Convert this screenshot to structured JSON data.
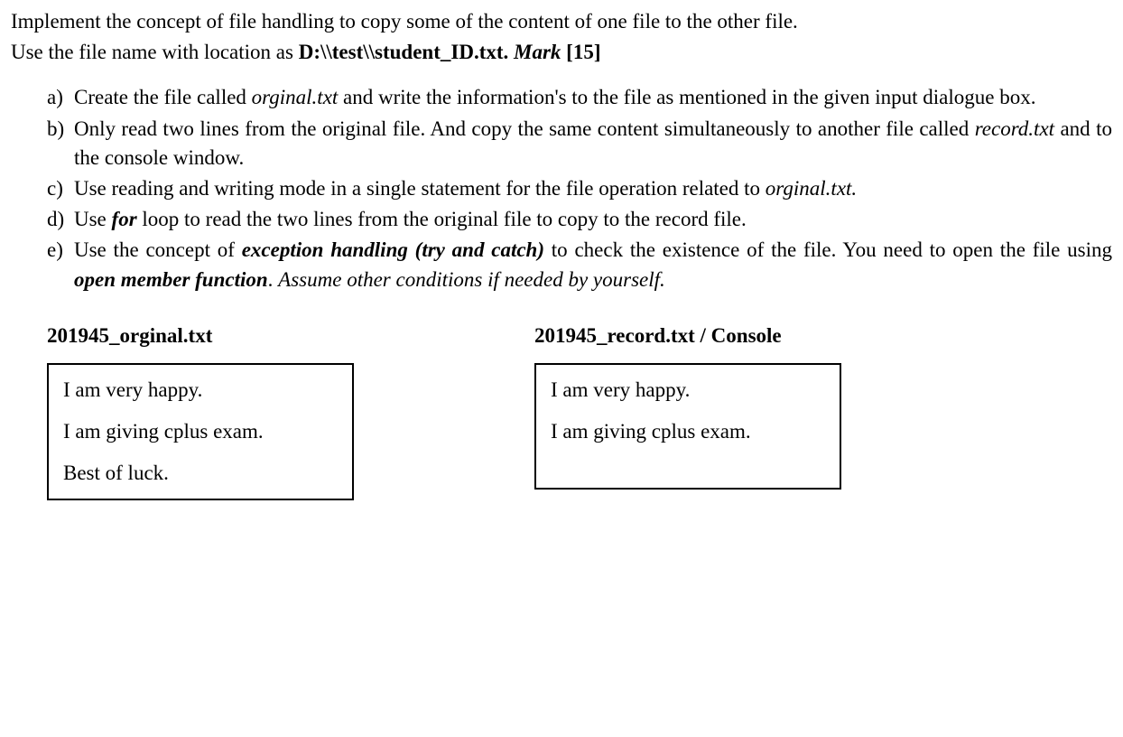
{
  "intro": {
    "line1": "Implement the concept of file handling to copy some of the content of one file to the other file.",
    "line2_prefix": "Use the file name with location as ",
    "line2_bold": "D:\\\\test\\\\student_ID.txt. ",
    "line2_mark_italic": "Mark",
    "line2_mark_suffix": " [15]"
  },
  "items": [
    {
      "marker": "a)",
      "parts": [
        {
          "text": "Create the file called ",
          "style": ""
        },
        {
          "text": "orginal.txt",
          "style": "italic"
        },
        {
          "text": " and write the information's to the file as mentioned in the given input dialogue box.",
          "style": ""
        }
      ]
    },
    {
      "marker": "b)",
      "parts": [
        {
          "text": "Only read two lines from the original file. And copy the same content simultaneously to another file called ",
          "style": ""
        },
        {
          "text": "record.txt",
          "style": "italic"
        },
        {
          "text": " and to the console window.",
          "style": ""
        }
      ]
    },
    {
      "marker": "c)",
      "parts": [
        {
          "text": "Use reading and writing mode in a single statement for the file operation related to ",
          "style": ""
        },
        {
          "text": "orginal.txt.",
          "style": "italic"
        }
      ]
    },
    {
      "marker": "d)",
      "parts": [
        {
          "text": "Use ",
          "style": ""
        },
        {
          "text": "for",
          "style": "bold-italic"
        },
        {
          "text": " loop to read the two lines from the original file to copy to the record file.",
          "style": ""
        }
      ]
    },
    {
      "marker": "e)",
      "parts": [
        {
          "text": "Use the concept of ",
          "style": ""
        },
        {
          "text": "exception handling (try and catch)",
          "style": "bold-italic"
        },
        {
          "text": " to check the existence of the file. You need to open the file using ",
          "style": ""
        },
        {
          "text": "open member function",
          "style": "bold-italic"
        },
        {
          "text": ". ",
          "style": ""
        },
        {
          "text": "Assume other conditions if needed by yourself.",
          "style": "italic"
        }
      ]
    }
  ],
  "boxes": {
    "left": {
      "title": "201945_orginal.txt",
      "lines": [
        "I am very happy.",
        "I am giving cplus exam.",
        "Best of luck."
      ]
    },
    "right": {
      "title": "201945_record.txt / Console",
      "lines": [
        "I am very happy.",
        "I am giving cplus exam."
      ]
    }
  }
}
